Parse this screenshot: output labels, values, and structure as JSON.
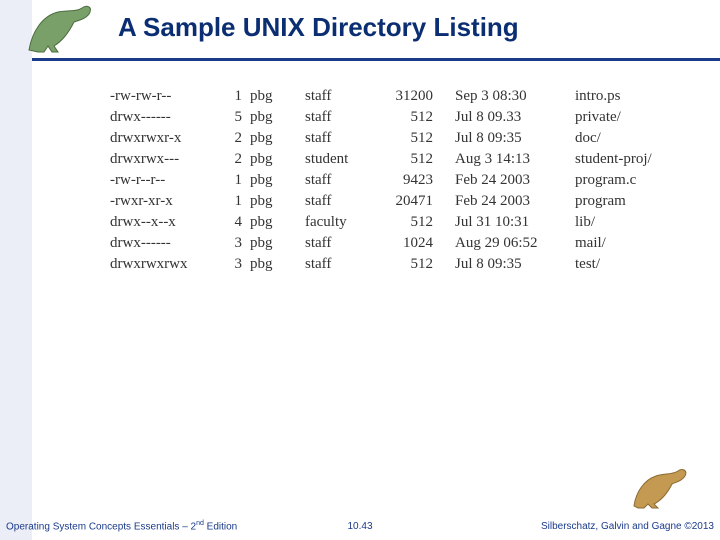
{
  "title": "A Sample UNIX Directory Listing",
  "footer": {
    "left_a": "Operating System Concepts Essentials – 2",
    "left_sup": "nd",
    "left_b": " Edition",
    "mid": "10.43",
    "right": "Silberschatz, Galvin and Gagne ©2013"
  },
  "listing": [
    {
      "perm": "-rw-rw-r--",
      "links": "1",
      "own": "pbg",
      "grp": "staff",
      "size": "31200",
      "date": "Sep 3 08:30",
      "name": "intro.ps"
    },
    {
      "perm": "drwx------",
      "links": "5",
      "own": "pbg",
      "grp": "staff",
      "size": "512",
      "date": "Jul 8 09.33",
      "name": "private/"
    },
    {
      "perm": "drwxrwxr-x",
      "links": "2",
      "own": "pbg",
      "grp": "staff",
      "size": "512",
      "date": "Jul 8 09:35",
      "name": "doc/"
    },
    {
      "perm": "drwxrwx---",
      "links": "2",
      "own": "pbg",
      "grp": "student",
      "size": "512",
      "date": "Aug 3 14:13",
      "name": "student-proj/"
    },
    {
      "perm": "-rw-r--r--",
      "links": "1",
      "own": "pbg",
      "grp": "staff",
      "size": "9423",
      "date": "Feb 24 2003",
      "name": "program.c"
    },
    {
      "perm": "-rwxr-xr-x",
      "links": "1",
      "own": "pbg",
      "grp": "staff",
      "size": "20471",
      "date": "Feb 24 2003",
      "name": "program"
    },
    {
      "perm": "drwx--x--x",
      "links": "4",
      "own": "pbg",
      "grp": "faculty",
      "size": "512",
      "date": "Jul 31 10:31",
      "name": "lib/"
    },
    {
      "perm": "drwx------",
      "links": "3",
      "own": "pbg",
      "grp": "staff",
      "size": "1024",
      "date": "Aug 29 06:52",
      "name": "mail/"
    },
    {
      "perm": "drwxrwxrwx",
      "links": "3",
      "own": "pbg",
      "grp": "staff",
      "size": "512",
      "date": "Jul 8 09:35",
      "name": "test/"
    }
  ]
}
